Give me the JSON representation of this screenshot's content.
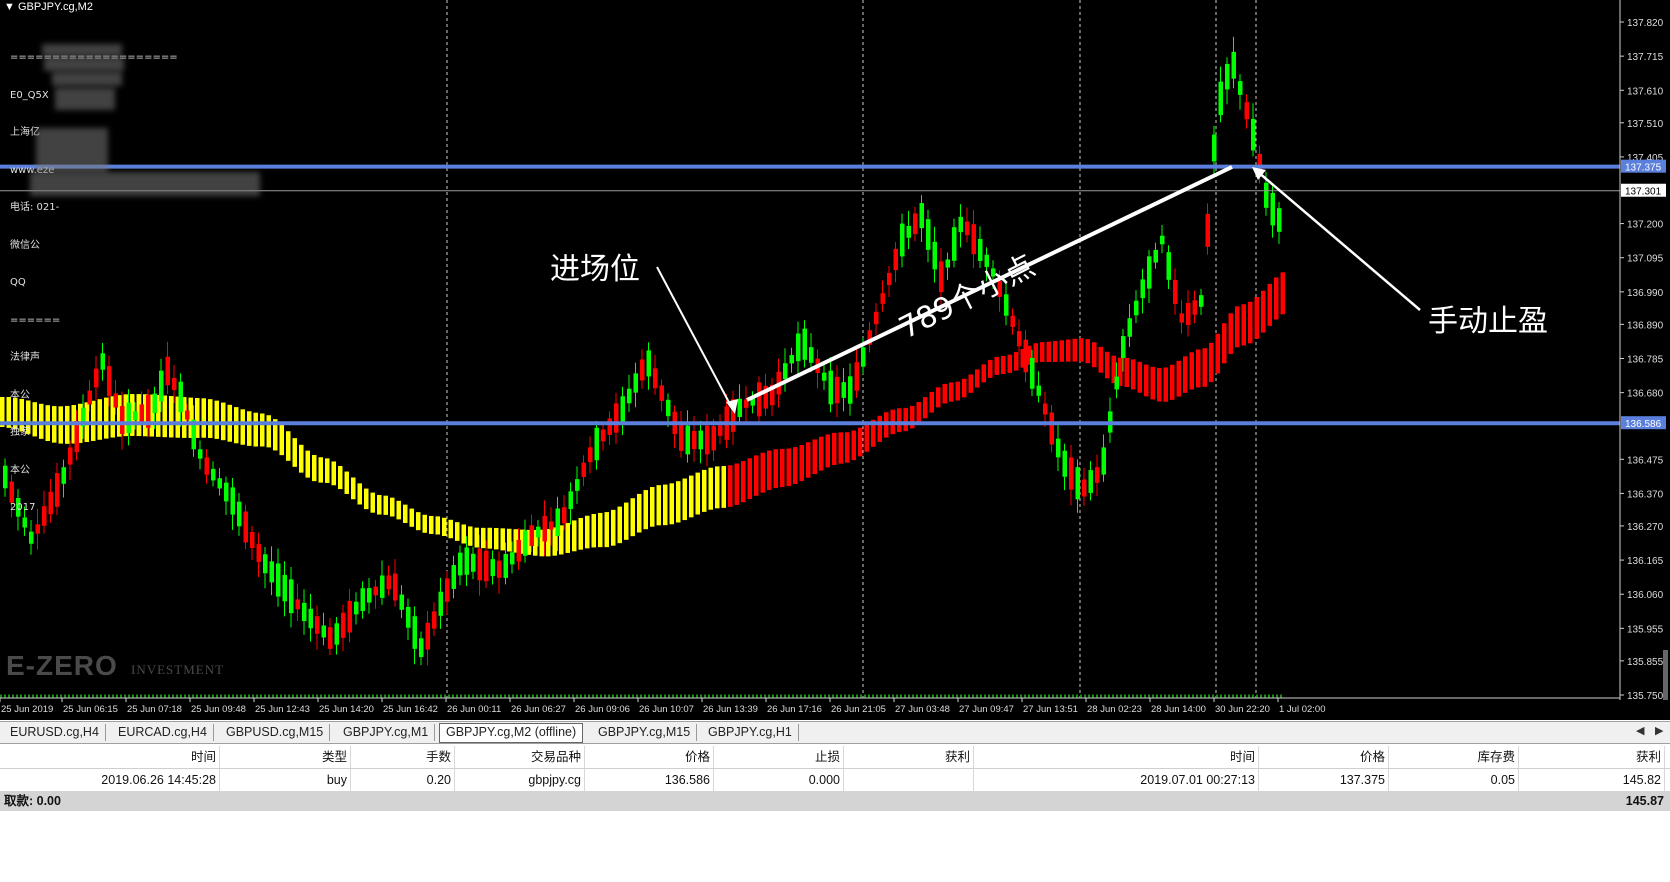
{
  "chart": {
    "symbol_title": "GBPJPY.cg,M2",
    "info_lines": [
      "====================",
      "E0_Q5X",
      "上海亿",
      "www.eze",
      "电话: 021-",
      "微信公",
      "QQ",
      "======",
      "法律声",
      "本公",
      "独家",
      "本公",
      "2017"
    ],
    "watermark_main": "E-ZERO",
    "watermark_sub": "INVESTMENT",
    "annotation_entry": "进场位",
    "annotation_pips": "789个小点",
    "annotation_exit": "手动止盈",
    "price_labels": [
      "137.820",
      "137.715",
      "137.610",
      "137.510",
      "137.405",
      "137.200",
      "137.095",
      "136.990",
      "136.890",
      "136.785",
      "136.680",
      "136.475",
      "136.370",
      "136.270",
      "136.165",
      "136.060",
      "135.955",
      "135.855",
      "135.750"
    ],
    "highlighted_prices": [
      "137.375",
      "137.301",
      "136.586"
    ],
    "time_labels": [
      "25 Jun 2019",
      "25 Jun 06:15",
      "25 Jun 07:18",
      "25 Jun 09:48",
      "25 Jun 12:43",
      "25 Jun 14:20",
      "25 Jun 16:42",
      "26 Jun 00:11",
      "26 Jun 06:27",
      "26 Jun 09:06",
      "26 Jun 10:07",
      "26 Jun 13:39",
      "26 Jun 17:16",
      "26 Jun 21:05",
      "27 Jun 03:48",
      "27 Jun 09:47",
      "27 Jun 13:51",
      "28 Jun 02:23",
      "28 Jun 14:00",
      "30 Jun 22:20",
      "1 Jul 02:00"
    ],
    "colors": {
      "background": "#000000",
      "bull": "#00ff00",
      "bear": "#ff0000",
      "band_yellow": "#ffff00",
      "band_red": "#ff0000",
      "level_line": "#5b7fdc"
    }
  },
  "tabs": [
    "EURUSD.cg,H4",
    "EURCAD.cg,H4",
    "GBPUSD.cg,M15",
    "GBPJPY.cg,M1",
    "GBPJPY.cg,M2 (offline)",
    "GBPJPY.cg,M15",
    "GBPJPY.cg,H1"
  ],
  "active_tab": "GBPJPY.cg,M2 (offline)",
  "history": {
    "headers": [
      "时间",
      "类型",
      "手数",
      "交易品种",
      "价格",
      "止损",
      "获利",
      "时间",
      "价格",
      "库存费",
      "获利"
    ],
    "row": [
      "2019.06.26 14:45:28",
      "buy",
      "0.20",
      "gbpjpy.cg",
      "136.586",
      "0.000",
      "",
      "2019.07.01 00:27:13",
      "137.375",
      "0.05",
      "145.82"
    ],
    "total_label": "取款: 0.00",
    "total_value": "145.87"
  }
}
